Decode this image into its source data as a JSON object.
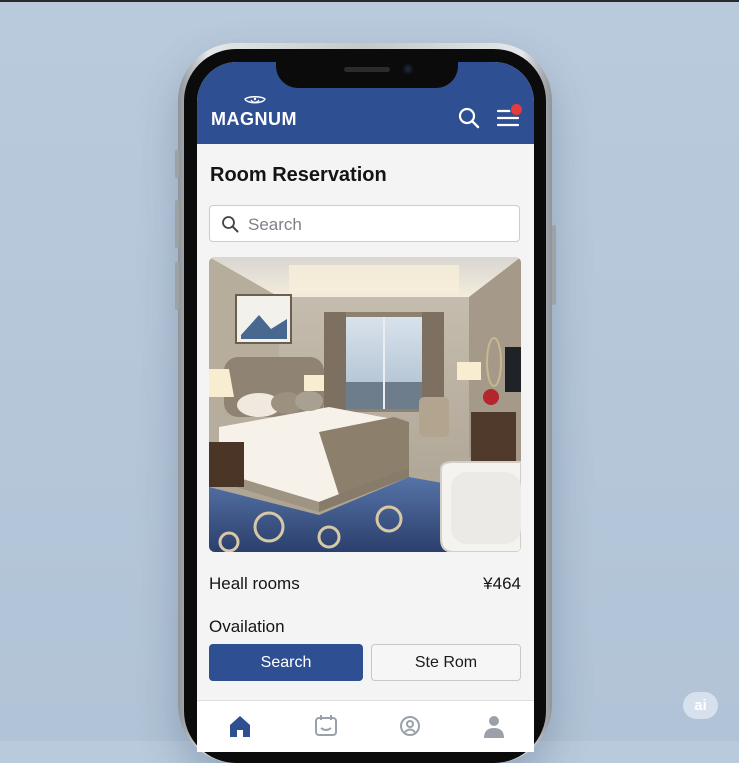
{
  "app": {
    "brand": "MAGNUM",
    "brand_color": "#2f4f93"
  },
  "page": {
    "title": "Room Reservation"
  },
  "search": {
    "placeholder": "Search"
  },
  "room": {
    "name": "Heall rooms",
    "price": "¥464",
    "availability_label": "Ovailation"
  },
  "actions": {
    "search_label": "Search",
    "secondary_label": "Ste Rom"
  },
  "tabs": [
    {
      "icon": "home-icon",
      "active": true
    },
    {
      "icon": "bookings-icon",
      "active": false
    },
    {
      "icon": "services-icon",
      "active": false
    },
    {
      "icon": "profile-icon",
      "active": false
    }
  ],
  "watermark": "ai",
  "notification_badge_color": "#e43b3b"
}
